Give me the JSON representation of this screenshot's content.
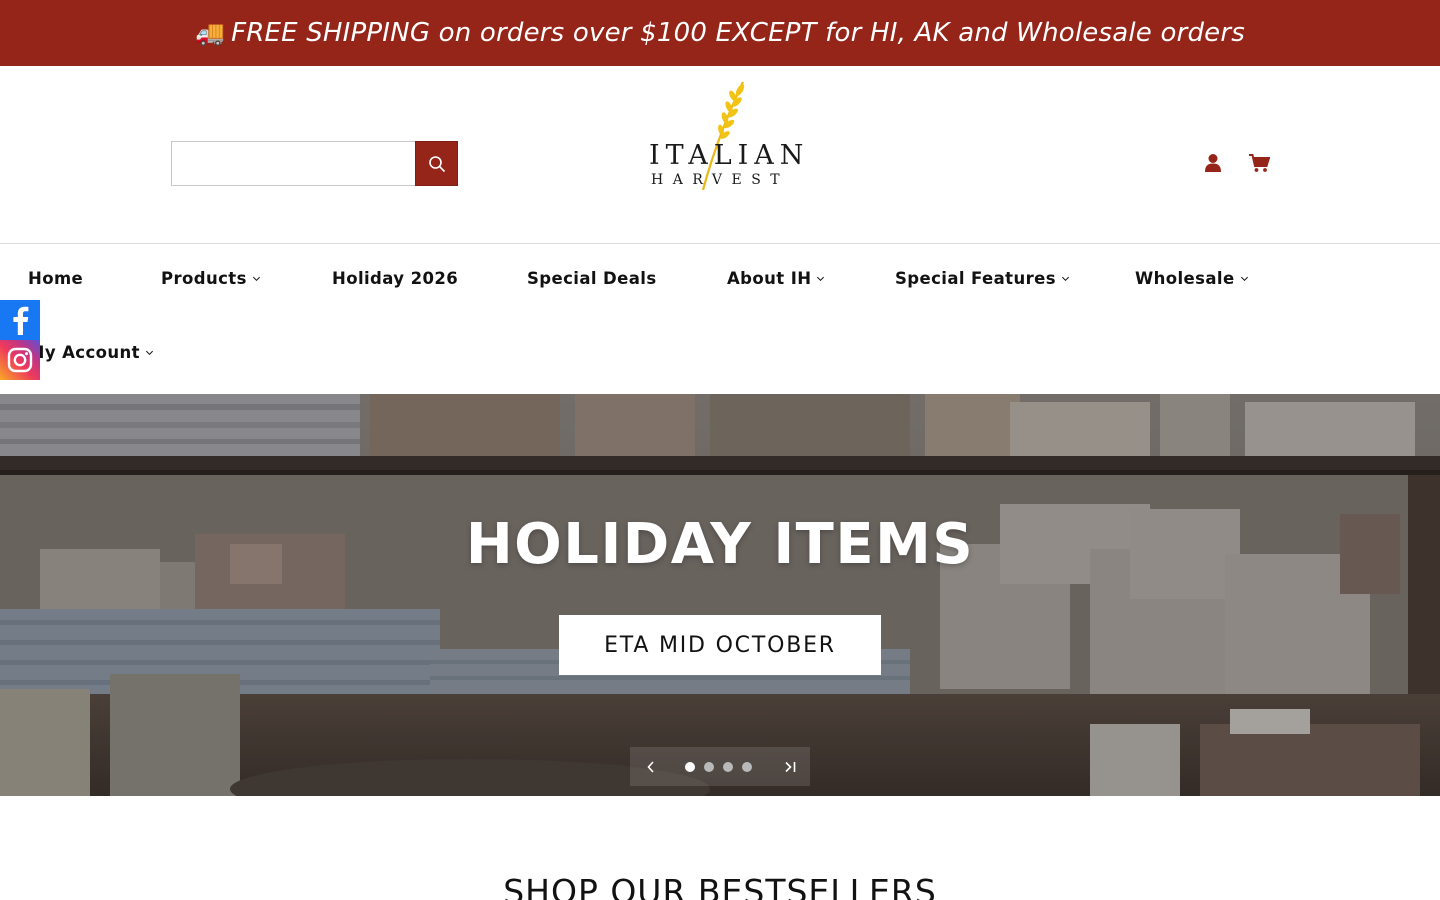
{
  "announcement": {
    "icon": "truck-emoji",
    "truck_glyph": "🚚",
    "text": "FREE SHIPPING on orders over $100 EXCEPT for HI, AK and Wholesale orders",
    "background": "#962519"
  },
  "header": {
    "search": {
      "placeholder": "",
      "value": "",
      "button_icon": "search-icon"
    },
    "logo": {
      "line1": "ITALIAN",
      "line2": "HARVEST"
    },
    "icons": {
      "account": "user-icon",
      "cart": "cart-icon"
    }
  },
  "nav": {
    "items": [
      {
        "label": "Home",
        "has_dropdown": false
      },
      {
        "label": "Products",
        "has_dropdown": true
      },
      {
        "label": "Holiday 2026",
        "has_dropdown": false
      },
      {
        "label": "Special Deals",
        "has_dropdown": false
      },
      {
        "label": "About IH",
        "has_dropdown": true
      },
      {
        "label": "Special Features",
        "has_dropdown": true
      },
      {
        "label": "Wholesale",
        "has_dropdown": true
      },
      {
        "label": "My Account",
        "has_dropdown": true
      }
    ]
  },
  "social": [
    "facebook-icon",
    "instagram-icon"
  ],
  "hero": {
    "title": "HOLIDAY ITEMS",
    "button_label": "ETA MID OCTOBER",
    "slides_total": 4,
    "active_slide": 1
  },
  "bestsellers": {
    "title": "SHOP OUR BESTSELLERS"
  },
  "colors": {
    "accent": "#962519",
    "text": "#121212"
  }
}
